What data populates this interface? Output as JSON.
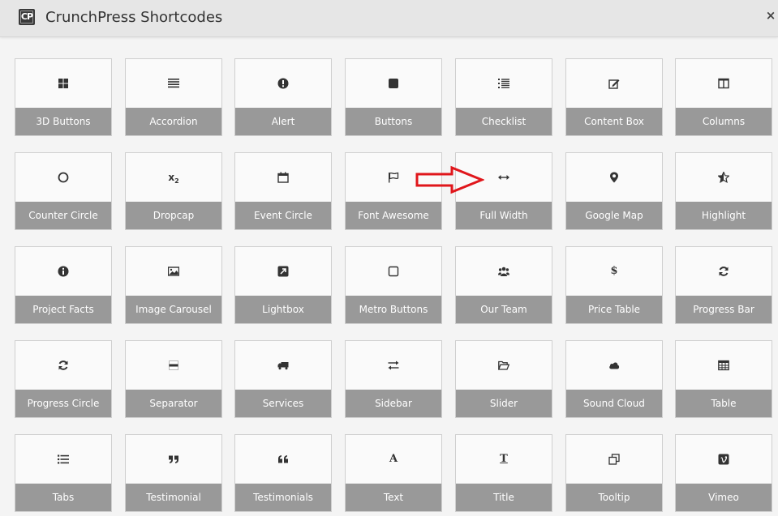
{
  "dialog": {
    "logo_text": "CP",
    "title": "CrunchPress Shortcodes",
    "close_symbol": "×"
  },
  "tiles": [
    {
      "label": "3D Buttons",
      "icon": "th-large-icon"
    },
    {
      "label": "Accordion",
      "icon": "align-justify-icon"
    },
    {
      "label": "Alert",
      "icon": "exclamation-circle-icon"
    },
    {
      "label": "Buttons",
      "icon": "stop-icon"
    },
    {
      "label": "Checklist",
      "icon": "list-ol-icon"
    },
    {
      "label": "Content Box",
      "icon": "edit-icon"
    },
    {
      "label": "Columns",
      "icon": "columns-icon"
    },
    {
      "label": "Counter Circle",
      "icon": "circle-icon"
    },
    {
      "label": "Dropcap",
      "icon": "subscript-icon"
    },
    {
      "label": "Event Circle",
      "icon": "calendar-icon"
    },
    {
      "label": "Font Awesome",
      "icon": "flag-icon"
    },
    {
      "label": "Full Width",
      "icon": "arrows-h-icon"
    },
    {
      "label": "Google Map",
      "icon": "map-marker-icon"
    },
    {
      "label": "Highlight",
      "icon": "star-half-icon"
    },
    {
      "label": "Project Facts",
      "icon": "info-circle-icon"
    },
    {
      "label": "Image Carousel",
      "icon": "picture-icon"
    },
    {
      "label": "Lightbox",
      "icon": "external-link-icon"
    },
    {
      "label": "Metro Buttons",
      "icon": "square-icon"
    },
    {
      "label": "Our Team",
      "icon": "users-icon"
    },
    {
      "label": "Price Table",
      "icon": "dollar-icon"
    },
    {
      "label": "Progress Bar",
      "icon": "refresh-icon"
    },
    {
      "label": "Progress Circle",
      "icon": "refresh-icon"
    },
    {
      "label": "Separator",
      "icon": "minus-square-icon"
    },
    {
      "label": "Services",
      "icon": "truck-icon"
    },
    {
      "label": "Sidebar",
      "icon": "exchange-icon"
    },
    {
      "label": "Slider",
      "icon": "folder-open-icon"
    },
    {
      "label": "Sound Cloud",
      "icon": "cloud-icon"
    },
    {
      "label": "Table",
      "icon": "table-icon"
    },
    {
      "label": "Tabs",
      "icon": "list-icon"
    },
    {
      "label": "Testimonial",
      "icon": "quote-right-icon"
    },
    {
      "label": "Testimonials",
      "icon": "quote-left-icon"
    },
    {
      "label": "Text",
      "icon": "font-icon"
    },
    {
      "label": "Title",
      "icon": "text-height-icon"
    },
    {
      "label": "Tooltip",
      "icon": "copy-icon"
    },
    {
      "label": "Vimeo",
      "icon": "vimeo-icon"
    }
  ],
  "icon_glyphs": {
    "font-icon": "A",
    "text-height-icon": "T",
    "dollar-icon": "$"
  },
  "annotation": {
    "arrow_color": "#e0161b",
    "points_to": "Full Width"
  },
  "colors": {
    "label_bar": "#999999",
    "tile_bg": "#fafafa",
    "header_bg": "#e6e6e6"
  }
}
